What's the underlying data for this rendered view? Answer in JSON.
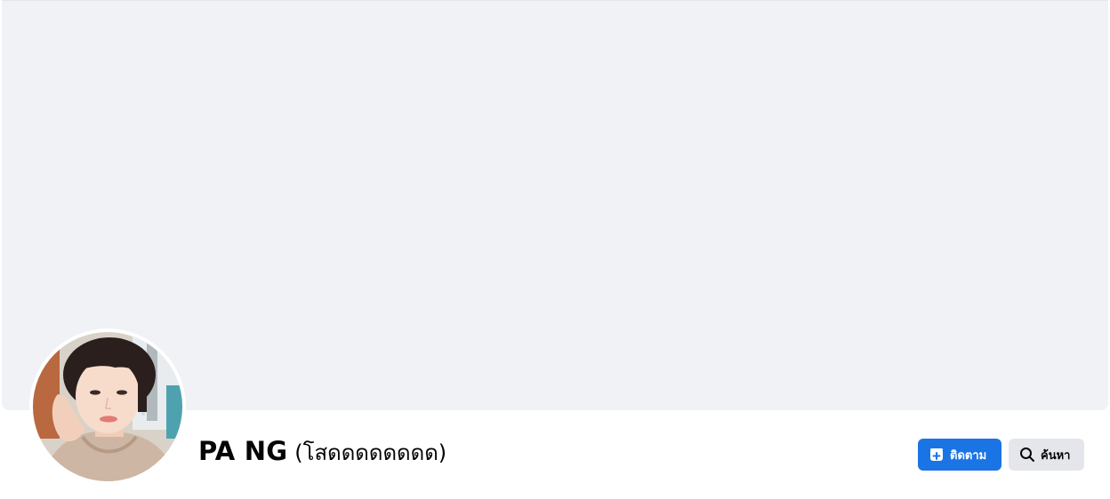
{
  "profile": {
    "name": "PA NG",
    "alternate_name": "(โสดดดดดดดด)"
  },
  "actions": {
    "follow_label": "ติดตาม",
    "search_label": "ค้นหา"
  },
  "icons": {
    "follow": "follow-icon",
    "search": "search-icon"
  },
  "colors": {
    "cover_background": "#f0f2f5",
    "follow_button": "#1b74e4",
    "search_button": "#e4e6eb",
    "text": "#050505"
  }
}
